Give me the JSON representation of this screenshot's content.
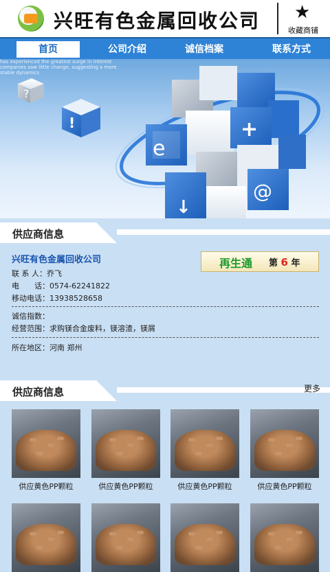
{
  "header": {
    "company_title": "兴旺有色金属回收公司",
    "favorite_label": "收藏商铺",
    "star_glyph": "★"
  },
  "nav": {
    "items": [
      {
        "label": "首页",
        "active": true
      },
      {
        "label": "公司介绍",
        "active": false
      },
      {
        "label": "诚信档案",
        "active": false
      },
      {
        "label": "联系方式",
        "active": false
      }
    ]
  },
  "banner": {
    "caption": "has experienced the greatest surge in interest companies saw little change, suggesting a more stable dynamics",
    "cube_symbols": [
      "?",
      "!",
      "e",
      "+",
      "@",
      "↓"
    ]
  },
  "supplier_info": {
    "section_title": "供应商信息",
    "company_name": "兴旺有色金属回收公司",
    "badge_main": "再生通",
    "badge_prefix": "第",
    "badge_year_num": "6",
    "badge_suffix": "年",
    "contact_label": "联 系 人：",
    "contact_value": "乔飞",
    "phone_label": "电　　话：",
    "phone_value": "0574-62241822",
    "mobile_label": "移动电话：",
    "mobile_value": "13938528658",
    "credit_label": "诚信指数：",
    "credit_value": "",
    "scope_label": "经营范围：",
    "scope_value": "求购镁合金废料，镁溶渣，镁屑",
    "region_label": "所在地区：",
    "region_value": "河南 郑州"
  },
  "products_section": {
    "section_title": "供应商信息",
    "more_label": "更多",
    "items": [
      {
        "caption": "供应黄色PP颗粒"
      },
      {
        "caption": "供应黄色PP颗粒"
      },
      {
        "caption": "供应黄色PP颗粒"
      },
      {
        "caption": "供应黄色PP颗粒"
      },
      {
        "caption": ""
      },
      {
        "caption": ""
      },
      {
        "caption": ""
      },
      {
        "caption": ""
      }
    ]
  },
  "colors": {
    "nav_bg": "#2f83d6",
    "page_bg": "#c9dff4",
    "company_name_blue": "#1a56b0",
    "badge_green": "#1c9a2c",
    "badge_red": "#e0261e"
  }
}
